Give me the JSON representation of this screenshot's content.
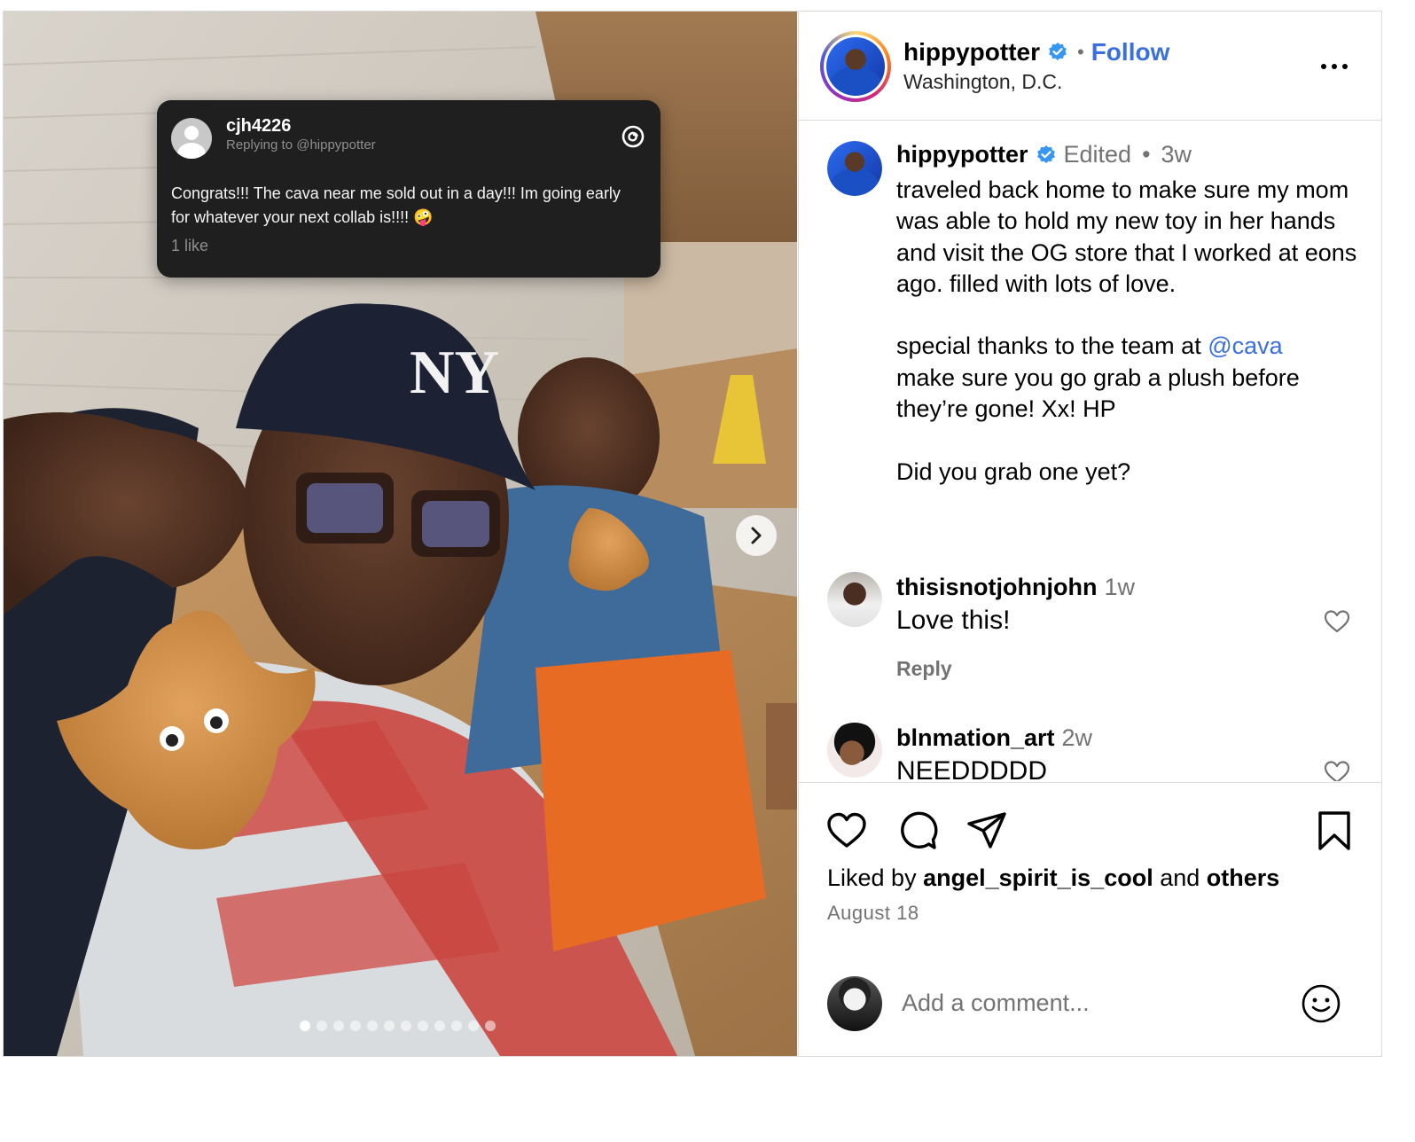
{
  "threads_card": {
    "username": "cjh4226",
    "replying_to": "Replying to @hippypotter",
    "text": "Congrats!!! The cava near me sold out in a day!!! Im going early for whatever your next collab is!!!! 🤪",
    "likes": "1 like"
  },
  "carousel": {
    "dot_count": 12,
    "active_index": 0
  },
  "header": {
    "username": "hippypotter",
    "separator": "•",
    "follow_label": "Follow",
    "location": "Washington, D.C."
  },
  "caption": {
    "username": "hippypotter",
    "edited_label": "Edited",
    "separator": "•",
    "time": "3w",
    "body_part1": "traveled back home to make sure my mom was able to hold my new toy in her hands and visit the OG store that I worked at eons ago. filled with lots of love.\n\nspecial thanks to the team at ",
    "mention": "@cava",
    "body_part2": "\nmake sure you go grab a plush before they’re gone! Xx! HP\n\nDid you grab one yet?"
  },
  "comments": [
    {
      "username": "thisisnotjohnjohn",
      "time": "1w",
      "text": "Love this!",
      "reply_label": "Reply"
    },
    {
      "username": "blnmation_art",
      "time": "2w",
      "text": "NEEDDDDD"
    }
  ],
  "liked_by": {
    "prefix": "Liked by",
    "user": "angel_spirit_is_cool",
    "connector": "and",
    "others": "others"
  },
  "post_date": "August 18",
  "add_comment": {
    "placeholder": "Add a comment..."
  },
  "colors": {
    "link_blue": "#3a6fe0",
    "secondary_text": "#737373",
    "border": "#dbdbdb",
    "verified": "#3797f0"
  }
}
